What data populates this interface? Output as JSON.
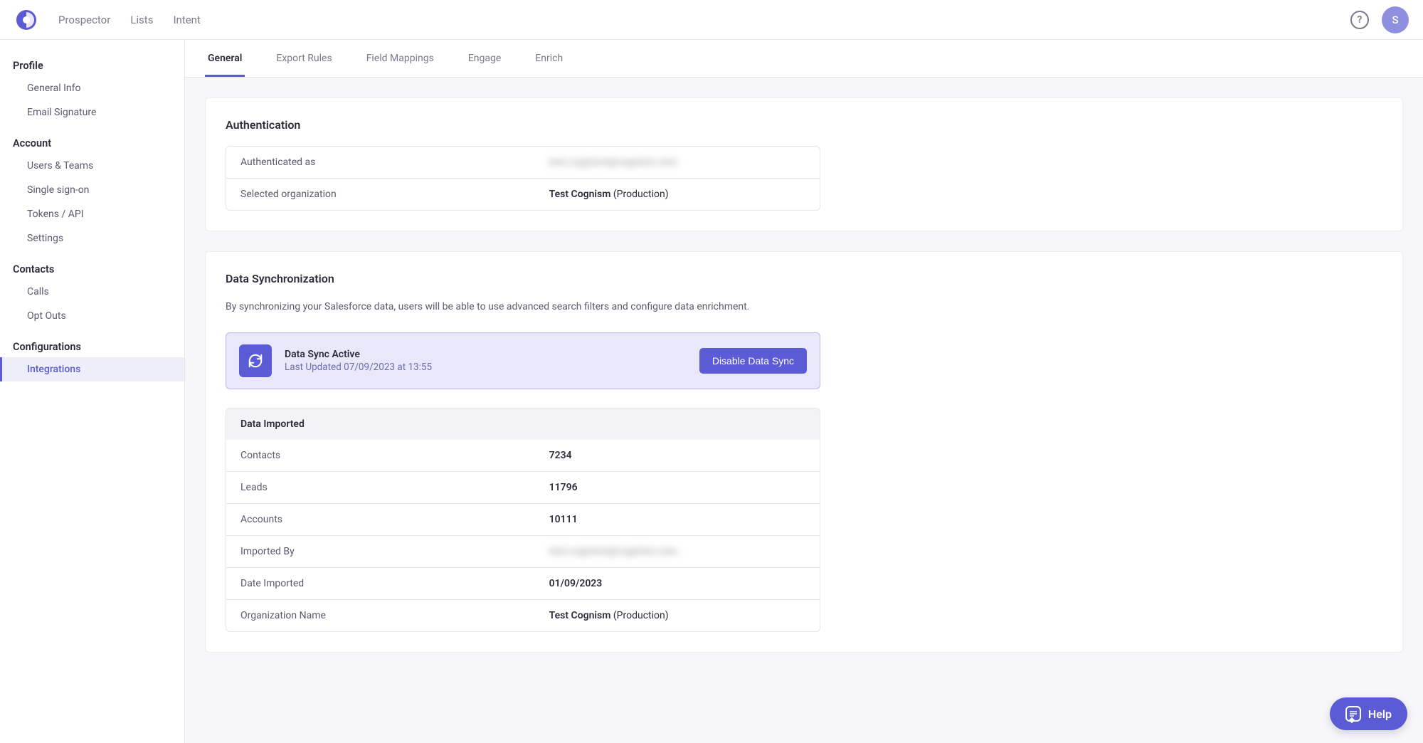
{
  "nav": {
    "items": [
      "Prospector",
      "Lists",
      "Intent"
    ],
    "avatar_initial": "S"
  },
  "sidebar": {
    "groups": [
      {
        "heading": "Profile",
        "items": [
          "General Info",
          "Email Signature"
        ]
      },
      {
        "heading": "Account",
        "items": [
          "Users & Teams",
          "Single sign-on",
          "Tokens / API",
          "Settings"
        ]
      },
      {
        "heading": "Contacts",
        "items": [
          "Calls",
          "Opt Outs"
        ]
      },
      {
        "heading": "Configurations",
        "items": [
          "Integrations"
        ]
      }
    ],
    "active": "Integrations"
  },
  "tabs": {
    "items": [
      "General",
      "Export Rules",
      "Field Mappings",
      "Engage",
      "Enrich"
    ],
    "active": "General"
  },
  "auth": {
    "title": "Authentication",
    "rows": [
      {
        "label": "Authenticated as",
        "value": "test.cognism@cognism.com",
        "blurred": true
      },
      {
        "label": "Selected organization",
        "value_bold": "Test Cognism",
        "value_rest": " (Production)"
      }
    ]
  },
  "sync": {
    "title": "Data Synchronization",
    "subtitle": "By synchronizing your Salesforce data, users will be able to use advanced search filters and configure data enrichment.",
    "banner": {
      "status": "Data Sync Active",
      "updated": "Last Updated 07/09/2023 at 13:55",
      "button": "Disable Data Sync"
    },
    "table_header": "Data Imported",
    "rows": [
      {
        "label": "Contacts",
        "value": "7234"
      },
      {
        "label": "Leads",
        "value": "11796"
      },
      {
        "label": "Accounts",
        "value": "10111"
      },
      {
        "label": "Imported By",
        "value": "test.cognism@cognism.com",
        "blurred": true
      },
      {
        "label": "Date Imported",
        "value": "01/09/2023"
      },
      {
        "label": "Organization Name",
        "value_bold": "Test Cognism",
        "value_rest": " (Production)"
      }
    ]
  },
  "help_fab": "Help"
}
